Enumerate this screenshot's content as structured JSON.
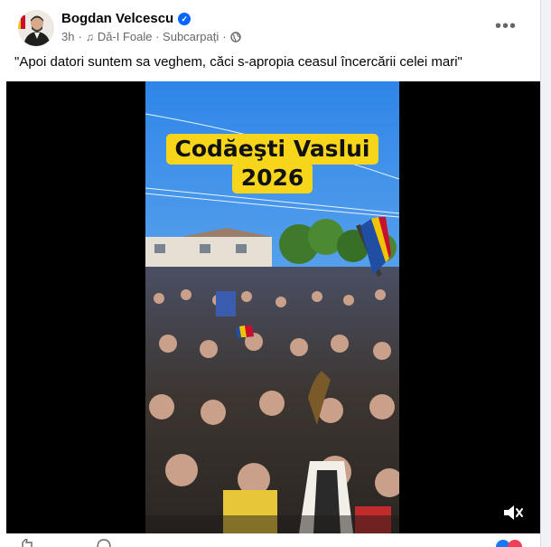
{
  "post": {
    "author": "Bogdan Velcescu",
    "time": "3h",
    "music": "Dă-I Foale · Subcarpați",
    "separator": "·",
    "caption": "\"Apoi datori suntem sa veghem, căci s-apropia ceasul încercării celei mari\""
  },
  "video": {
    "overlay_line1": "Codăeşti Vaslui",
    "overlay_line2": "2026",
    "muted": true
  },
  "icons": {
    "verified": "verified-badge-icon",
    "music": "music-note-icon",
    "privacy": "globe-icon",
    "more": "more-options-icon",
    "mute": "speaker-muted-icon"
  },
  "colors": {
    "accent": "#0866ff",
    "overlay": "#f7d51b",
    "secondary_text": "#65676b"
  }
}
